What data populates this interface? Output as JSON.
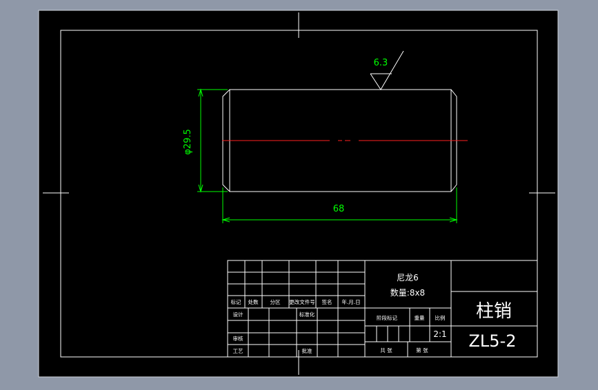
{
  "colors": {
    "background": "#8f98a8",
    "sheet": "#000000",
    "line": "#ffffff",
    "dimension": "#00ff00",
    "centerline": "#ff0000"
  },
  "drawing": {
    "roughness_value": "6.3",
    "diameter_dim": "φ29.5",
    "length_dim": "68"
  },
  "title_block": {
    "material": "尼龙6",
    "quantity": "数量:8x8",
    "part_name": "柱销",
    "part_code": "ZL5-2",
    "scale": "2:1",
    "header_labels": {
      "mark": "标记",
      "count": "处数",
      "zone": "分区",
      "change_doc": "更改文件号",
      "signature": "签名",
      "date": "年.月.日"
    },
    "row_labels": {
      "design": "设计",
      "standardize": "标准化",
      "review": "审核",
      "process": "工艺",
      "approve": "批准"
    },
    "info_labels": {
      "stage": "阶段标记",
      "weight": "重量",
      "scale": "比例",
      "total": "共 张",
      "sheet": "第 张"
    }
  }
}
